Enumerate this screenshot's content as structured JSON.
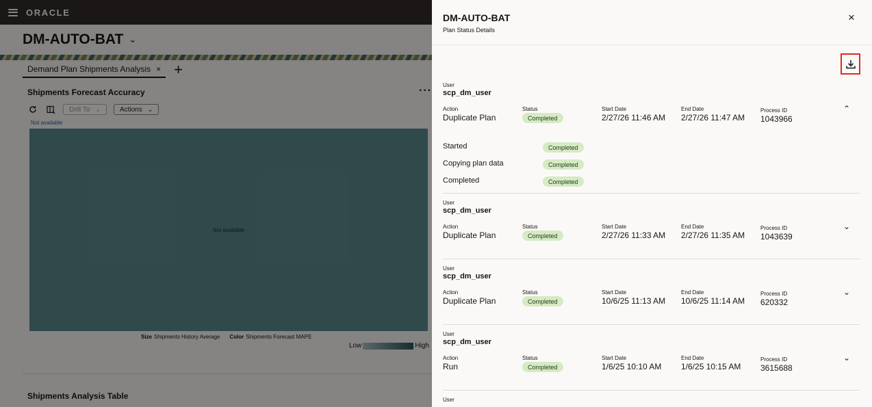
{
  "app": {
    "logo": "ORACLE",
    "page_title": "DM-AUTO-BAT",
    "tab_label": "Demand Plan Shipments Analysis",
    "tab_close": "×",
    "tab_add": "+",
    "section_title": "Shipments Forecast Accuracy",
    "more": "···",
    "drill_to": "Drill To",
    "actions": "Actions",
    "not_available_top": "Not available",
    "not_available_center": "Not available",
    "legend_size_label": "Size",
    "legend_size_value": "Shipments History Average",
    "legend_color_label": "Color",
    "legend_color_value": "Shipments Forecast MAPE",
    "scale_low": "Low",
    "scale_high": "High",
    "table_title": "Shipments Analysis Table",
    "treemap_color": "#5c8c8e"
  },
  "drawer": {
    "title": "DM-AUTO-BAT",
    "subtitle": "Plan Status Details",
    "close": "×",
    "labels": {
      "user": "User",
      "action": "Action",
      "status": "Status",
      "start_date": "Start Date",
      "end_date": "End Date",
      "process_id": "Process ID"
    },
    "entries": [
      {
        "user": "scp_dm_user",
        "action": "Duplicate Plan",
        "status": "Completed",
        "start": "2/27/26 11:46 AM",
        "end": "2/27/26 11:47 AM",
        "process_id": "1043966",
        "expanded": true,
        "steps": [
          {
            "name": "Started",
            "status": "Completed"
          },
          {
            "name": "Copying plan data",
            "status": "Completed"
          },
          {
            "name": "Completed",
            "status": "Completed"
          }
        ]
      },
      {
        "user": "scp_dm_user",
        "action": "Duplicate Plan",
        "status": "Completed",
        "start": "2/27/26 11:33 AM",
        "end": "2/27/26 11:35 AM",
        "process_id": "1043639",
        "expanded": false
      },
      {
        "user": "scp_dm_user",
        "action": "Duplicate Plan",
        "status": "Completed",
        "start": "10/6/25 11:13 AM",
        "end": "10/6/25 11:14 AM",
        "process_id": "620332",
        "expanded": false
      },
      {
        "user": "scp_dm_user",
        "action": "Run",
        "status": "Completed",
        "start": "1/6/25 10:10 AM",
        "end": "1/6/25 10:15 AM",
        "process_id": "3615688",
        "expanded": false
      }
    ],
    "partial_next_label": "User",
    "status_color": "#d6eac3",
    "highlight_color": "#e22822"
  }
}
